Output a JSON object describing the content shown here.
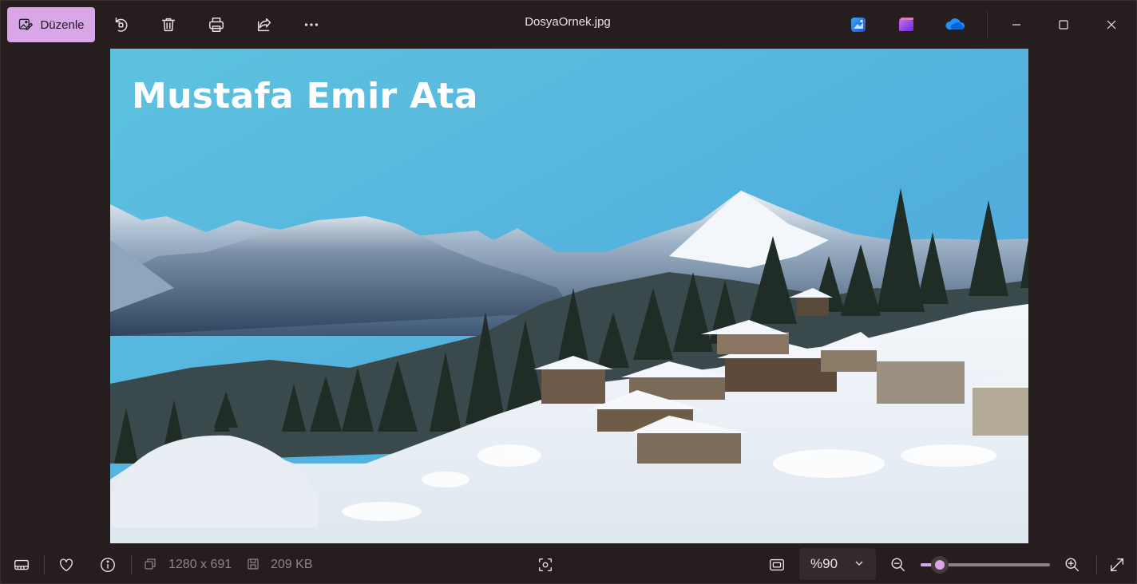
{
  "toolbar": {
    "edit_label": "Düzenle",
    "icons": [
      "rotate-icon",
      "delete-icon",
      "print-icon",
      "share-icon",
      "more-icon"
    ]
  },
  "window": {
    "title": "DosyaOrnek.jpg",
    "apps": [
      "photo-editor-icon",
      "clipchamp-icon",
      "onedrive-icon"
    ],
    "controls": [
      "minimize-icon",
      "maximize-icon",
      "close-icon"
    ]
  },
  "image": {
    "overlay_text": "Mustafa Emir Ata"
  },
  "statusbar": {
    "dimensions": "1280 x 691",
    "file_size": "209 KB",
    "zoom_value": "%90",
    "zoom_fraction": 0.15
  },
  "colors": {
    "accent": "#d9a7e8",
    "background": "#251d1e"
  }
}
